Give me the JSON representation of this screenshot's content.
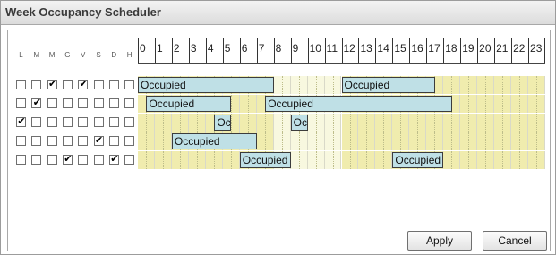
{
  "window": {
    "title": "Week Occupancy Scheduler"
  },
  "days": [
    {
      "letter": "L"
    },
    {
      "letter": "M"
    },
    {
      "letter": "M"
    },
    {
      "letter": "G"
    },
    {
      "letter": "V"
    },
    {
      "letter": "S"
    },
    {
      "letter": "D"
    },
    {
      "letter": "H"
    }
  ],
  "hours": [
    "0",
    "1",
    "2",
    "3",
    "4",
    "5",
    "6",
    "7",
    "8",
    "9",
    "10",
    "11",
    "12",
    "13",
    "14",
    "15",
    "16",
    "17",
    "18",
    "19",
    "20",
    "21",
    "22",
    "23"
  ],
  "rows": [
    {
      "checks": [
        false,
        false,
        true,
        false,
        true,
        false,
        false,
        false
      ],
      "blocks": [
        {
          "label": "Occupied",
          "start": 0,
          "end": 8
        },
        {
          "label": "Occupied",
          "start": 12,
          "end": 17.5
        }
      ]
    },
    {
      "checks": [
        false,
        true,
        false,
        false,
        false,
        false,
        false,
        false
      ],
      "blocks": [
        {
          "label": "Occupied",
          "start": 0.5,
          "end": 5.5
        },
        {
          "label": "Occupied",
          "start": 7.5,
          "end": 18.5
        }
      ]
    },
    {
      "checks": [
        true,
        false,
        false,
        false,
        false,
        false,
        false,
        false
      ],
      "blocks": [
        {
          "label": "Oc..",
          "start": 4.5,
          "end": 5.5
        },
        {
          "label": "Oc..",
          "start": 9,
          "end": 10
        }
      ]
    },
    {
      "checks": [
        false,
        false,
        false,
        false,
        false,
        true,
        false,
        false
      ],
      "blocks": [
        {
          "label": "Occupied",
          "start": 2,
          "end": 7
        }
      ]
    },
    {
      "checks": [
        false,
        false,
        false,
        true,
        false,
        false,
        true,
        false
      ],
      "blocks": [
        {
          "label": "Occupied",
          "start": 6,
          "end": 9
        },
        {
          "label": "Occupied",
          "start": 15,
          "end": 18
        }
      ]
    }
  ],
  "day_period": {
    "start": 8,
    "end": 12,
    "label_note": ""
  },
  "buttons": {
    "apply": "Apply",
    "cancel": "Cancel"
  },
  "colors": {
    "block": "#bfe0e6",
    "day": "#f8f8df",
    "night": "#f0ecae"
  }
}
